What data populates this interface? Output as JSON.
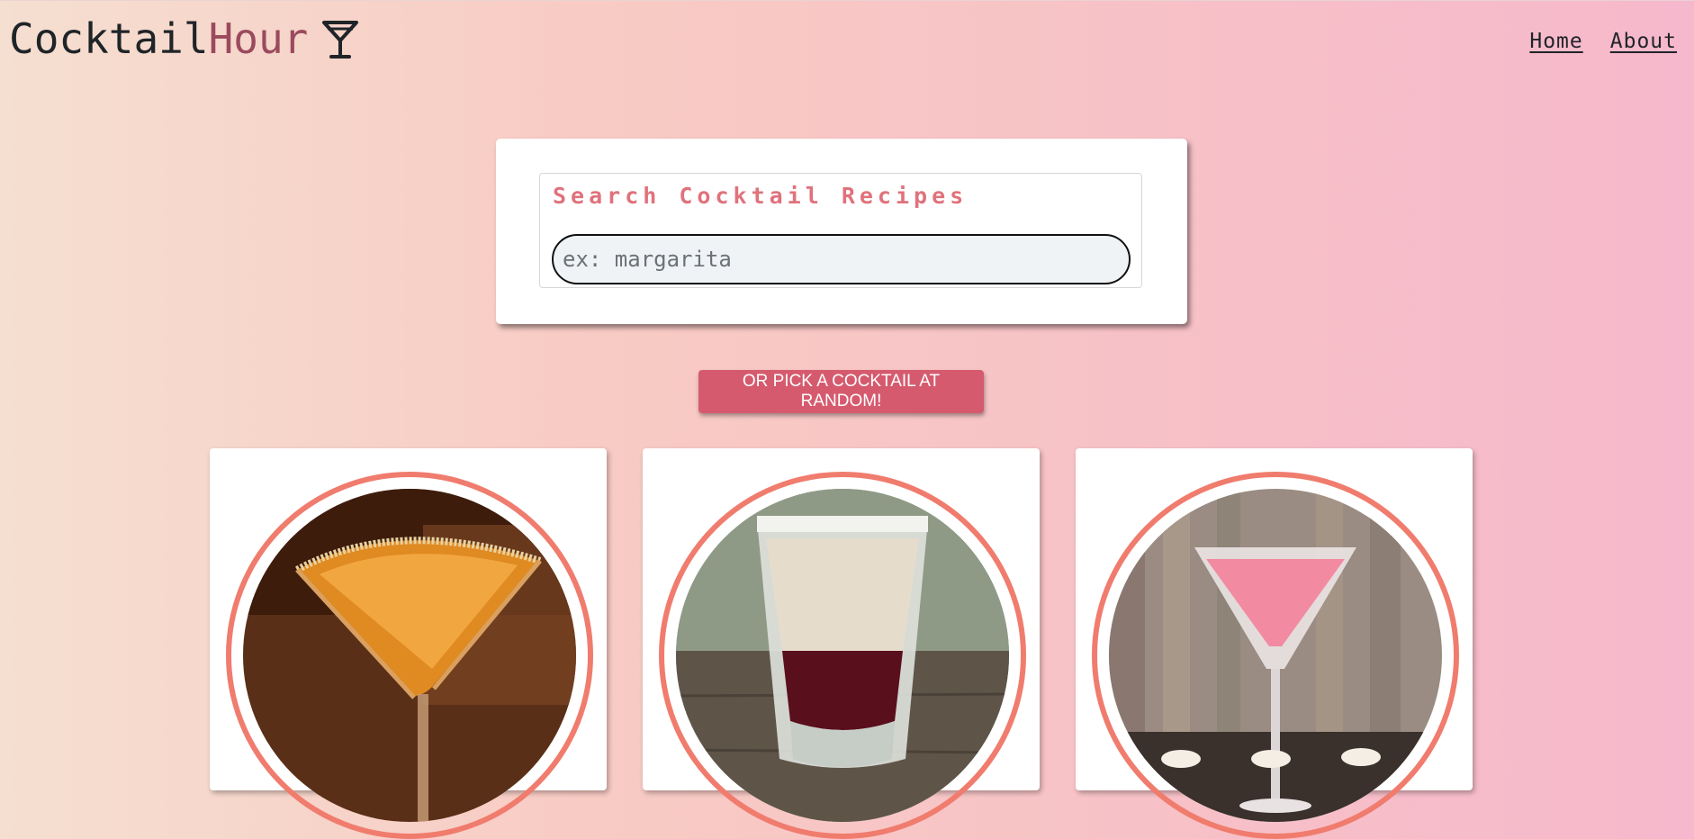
{
  "header": {
    "logo_part1": "Cocktail",
    "logo_part2": "Hour",
    "logo_icon": "martini-glass-icon",
    "nav": [
      {
        "label": "Home"
      },
      {
        "label": "About"
      }
    ]
  },
  "search": {
    "title": "Search Cocktail Recipes",
    "placeholder": "ex: margarita",
    "value": ""
  },
  "random_button": {
    "label": "OR PICK A COCKTAIL AT RANDOM!"
  },
  "cards": [
    {
      "image": "orange-martini-sugar-rim-photo"
    },
    {
      "image": "layered-shot-glass-photo"
    },
    {
      "image": "pink-martini-photo"
    }
  ],
  "colors": {
    "accent": "#d65a6e",
    "title_pink": "#e0727c",
    "ring_coral": "#f07c6e",
    "logo_hour": "#9b4a5e"
  }
}
